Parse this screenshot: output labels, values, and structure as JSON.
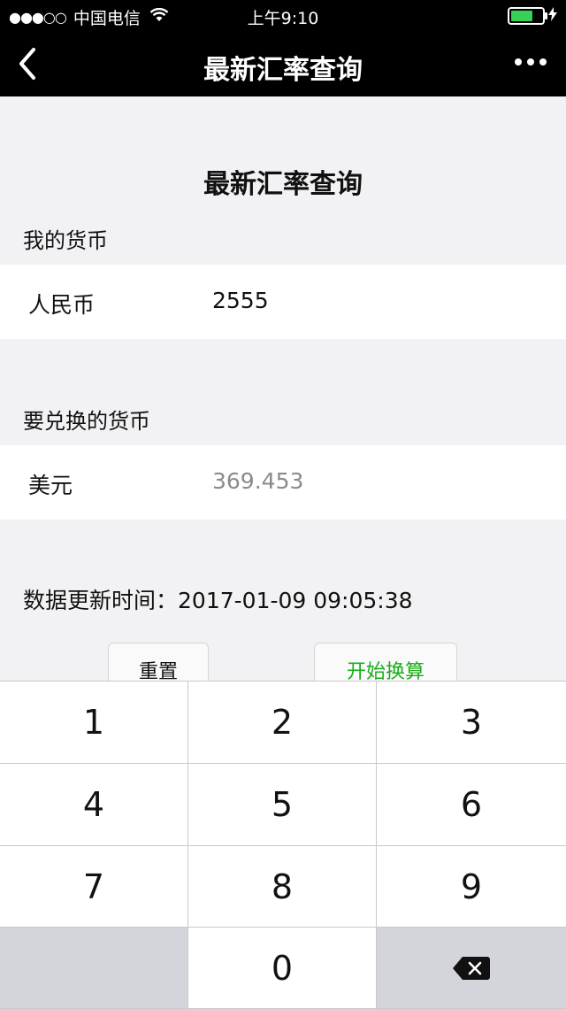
{
  "status": {
    "signal": "●●●○○",
    "carrier": "中国电信",
    "time": "上午9:10"
  },
  "nav": {
    "title": "最新汇率查询"
  },
  "page": {
    "heading": "最新汇率查询",
    "my_currency_label": "我的货币",
    "my_currency": {
      "name": "人民币",
      "value": "2555"
    },
    "target_currency_label": "要兑换的货币",
    "target_currency": {
      "name": "美元",
      "value": "369.453"
    },
    "update_label": "数据更新时间：",
    "update_time": "2017-01-09 09:05:38",
    "reset_label": "重置",
    "convert_label": "开始换算"
  },
  "keypad": {
    "keys": [
      "1",
      "2",
      "3",
      "4",
      "5",
      "6",
      "7",
      "8",
      "9",
      "0"
    ]
  },
  "colors": {
    "accent_green": "#19ad19",
    "battery_green": "#37d157",
    "bar_black": "#000000"
  }
}
